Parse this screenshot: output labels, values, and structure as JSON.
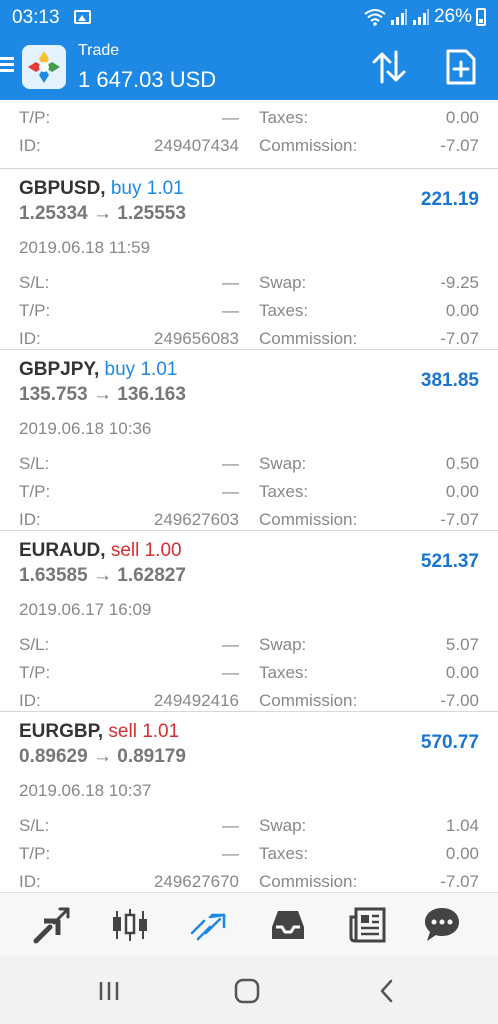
{
  "status_bar": {
    "time": "03:13",
    "battery": "26%"
  },
  "app_bar": {
    "title": "Trade",
    "balance": "1 647.03 USD"
  },
  "labels": {
    "sl": "S/L:",
    "tp": "T/P:",
    "id": "ID:",
    "swap": "Swap:",
    "taxes": "Taxes:",
    "commission": "Commission:"
  },
  "partial_trade": {
    "tp": "—",
    "id": "249407434",
    "taxes": "0.00",
    "commission": "-7.07"
  },
  "trades": [
    {
      "symbol": "GBPUSD,",
      "action": "buy 1.01",
      "side": "buy",
      "open_price": "1.25334",
      "arrow": "→",
      "close_price": "1.25553",
      "profit": "221.19",
      "time": "2019.06.18 11:59",
      "sl": "—",
      "tp": "—",
      "id": "249656083",
      "swap": "-9.25",
      "taxes": "0.00",
      "commission": "-7.07"
    },
    {
      "symbol": "GBPJPY,",
      "action": "buy 1.01",
      "side": "buy",
      "open_price": "135.753",
      "arrow": "→",
      "close_price": "136.163",
      "profit": "381.85",
      "time": "2019.06.18 10:36",
      "sl": "—",
      "tp": "—",
      "id": "249627603",
      "swap": "0.50",
      "taxes": "0.00",
      "commission": "-7.07"
    },
    {
      "symbol": "EURAUD,",
      "action": "sell 1.00",
      "side": "sell",
      "open_price": "1.63585",
      "arrow": "→",
      "close_price": "1.62827",
      "profit": "521.37",
      "time": "2019.06.17 16:09",
      "sl": "—",
      "tp": "—",
      "id": "249492416",
      "swap": "5.07",
      "taxes": "0.00",
      "commission": "-7.00"
    },
    {
      "symbol": "EURGBP,",
      "action": "sell 1.01",
      "side": "sell",
      "open_price": "0.89629",
      "arrow": "→",
      "close_price": "0.89179",
      "profit": "570.77",
      "time": "2019.06.18 10:37",
      "sl": "—",
      "tp": "—",
      "id": "249627670",
      "swap": "1.04",
      "taxes": "0.00",
      "commission": "-7.07"
    }
  ],
  "bottom_nav": [
    "quotes-icon",
    "charts-icon",
    "trade-icon",
    "history-icon",
    "news-icon",
    "chat-icon"
  ],
  "active_tab": "trade-icon",
  "colors": {
    "brand": "#1e88e5",
    "buy": "#1e88e5",
    "sell": "#d32f2f",
    "profit": "#1976d2"
  }
}
